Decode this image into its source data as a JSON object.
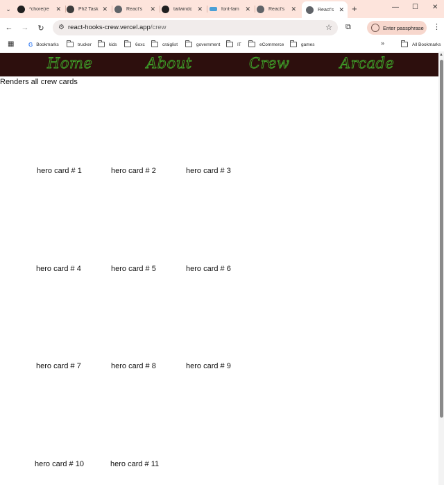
{
  "browser": {
    "tabs": [
      {
        "title": "*chore(re",
        "favicon_color": "#1f1f1f"
      },
      {
        "title": "Ph2 Task",
        "favicon_color": "#3c3c3c"
      },
      {
        "title": "React's",
        "favicon_color": "#5f6368"
      },
      {
        "title": "tailwindc",
        "favicon_color": "#1f1f1f"
      },
      {
        "title": "font-fam",
        "favicon_color": "#4a9fd6"
      },
      {
        "title": "React's",
        "favicon_color": "#5f6368"
      },
      {
        "title": "React's",
        "favicon_color": "#5f6368",
        "active": true
      }
    ],
    "new_tab_icon": "plus-icon",
    "url_host": "react-hooks-crew.vercel.app",
    "url_path": "/crew",
    "passphrase_label": "Enter passphrase",
    "bookmarks": [
      {
        "label": "Bookmarks",
        "icon": "google-icon"
      },
      {
        "label": "trucker",
        "icon": "folder-icon"
      },
      {
        "label": "kids",
        "icon": "folder-icon"
      },
      {
        "label": "6oxc",
        "icon": "folder-icon"
      },
      {
        "label": "craiglist",
        "icon": "folder-icon"
      },
      {
        "label": "government",
        "icon": "folder-icon"
      },
      {
        "label": "IT",
        "icon": "folder-icon"
      },
      {
        "label": "eCommerce",
        "icon": "folder-icon"
      },
      {
        "label": "games",
        "icon": "folder-icon"
      }
    ],
    "all_bookmarks_label": "All Bookmarks"
  },
  "page": {
    "nav": {
      "home": "Home",
      "about": "About",
      "crew": "Crew",
      "arcade": "Arcade"
    },
    "nav_bg_color": "#2d0f0d",
    "nav_text_color": "#3fa62a",
    "caption": "Renders all crew cards",
    "cards": [
      "hero card # 1",
      "hero card # 2",
      "hero card # 3",
      "hero card # 4",
      "hero card # 5",
      "hero card # 6",
      "hero card # 7",
      "hero card # 8",
      "hero card # 9",
      "hero card # 10",
      "hero card # 11"
    ]
  }
}
